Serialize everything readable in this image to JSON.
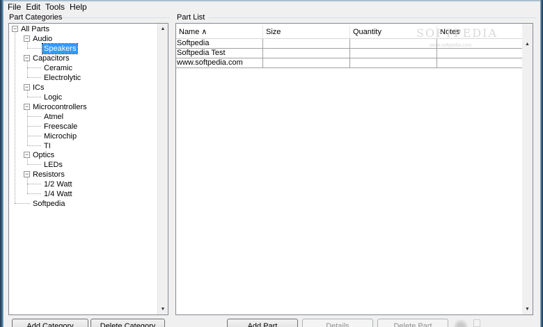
{
  "menu": [
    "File",
    "Edit",
    "Tools",
    "Help"
  ],
  "categories": {
    "title": "Part Categories",
    "tree": [
      {
        "label": "All Parts",
        "expander": "−"
      },
      {
        "label": "Audio",
        "expander": "−"
      },
      {
        "label": "Speakers",
        "selected": true
      },
      {
        "label": "Capacitors",
        "expander": "−"
      },
      {
        "label": "Ceramic"
      },
      {
        "label": "Electrolytic"
      },
      {
        "label": "ICs",
        "expander": "−"
      },
      {
        "label": "Logic"
      },
      {
        "label": "Microcontrollers",
        "expander": "−"
      },
      {
        "label": "Atmel"
      },
      {
        "label": "Freescale"
      },
      {
        "label": "Microchip"
      },
      {
        "label": "TI"
      },
      {
        "label": "Optics",
        "expander": "−"
      },
      {
        "label": "LEDs"
      },
      {
        "label": "Resistors",
        "expander": "−"
      },
      {
        "label": "1/2 Watt"
      },
      {
        "label": "1/4 Watt"
      },
      {
        "label": "Softpedia"
      }
    ],
    "add_button": "Add Category",
    "delete_button": "Delete Category"
  },
  "parts": {
    "title": "Part List",
    "columns": [
      "Name ∧",
      "Size",
      "Quantity",
      "Notes"
    ],
    "rows": [
      [
        "Softpedia",
        "",
        "",
        ""
      ],
      [
        "Softpedia Test",
        "",
        "",
        ""
      ],
      [
        "www.softpedia.com",
        "",
        "",
        ""
      ]
    ],
    "watermark": "SOFTPEDIA",
    "watermark_url": "www.softpedia.com",
    "add_button": "Add Part",
    "details_button": "Details",
    "delete_button": "Delete Part"
  },
  "icons": {
    "expander": "minus-box-icon",
    "scroll_up": "scroll-up-arrow-icon",
    "scroll_down": "scroll-down-arrow-icon"
  },
  "colors": {
    "selection": "#3399ff",
    "frame": "#3b6b8f"
  }
}
